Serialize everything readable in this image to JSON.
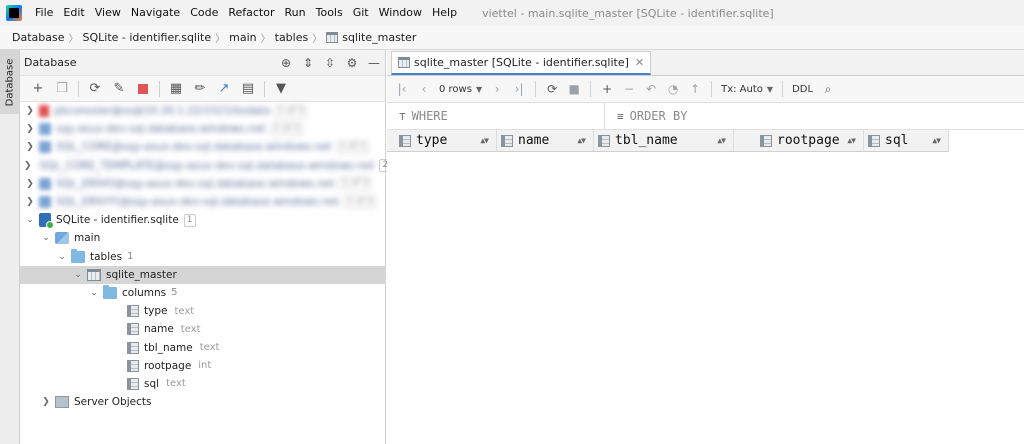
{
  "menu": [
    "File",
    "Edit",
    "View",
    "Navigate",
    "Code",
    "Refactor",
    "Run",
    "Tools",
    "Git",
    "Window",
    "Help"
  ],
  "window_title": "viettel - main.sqlite_master [SQLite - identifier.sqlite]",
  "breadcrumb": [
    "Database",
    "SQLite - identifier.sqlite",
    "main",
    "tables",
    "sqlite_master"
  ],
  "stripe_label": "Database",
  "db_panel": {
    "title": "Database"
  },
  "tree": {
    "blurred": [
      {
        "label": "pbconsoler@ss@10.30.1.22/1521/bsdata",
        "badge": "1 of 2",
        "icon": "red"
      },
      {
        "label": "sqy-asux-dev-sql.database.windows.net",
        "badge": "1 of 2",
        "icon": "blue"
      },
      {
        "label": "SQL_CORE@sqy-asux-dev-sql.database.windows.net",
        "badge": "1 of 2",
        "icon": "blue"
      },
      {
        "label": "SQL_CORE_TEMPLATE@sqy-asux-dev-sql.database.windows.net",
        "badge": "2",
        "icon": "blue"
      },
      {
        "label": "SQL_ERIVO@sqy-asux-dev-sql.database.windows.net",
        "badge": "1 of 2",
        "icon": "blue"
      },
      {
        "label": "SQL_ERIVYY@sqy-asux-dev-sql.database.windows.net",
        "badge": "1 of 2",
        "icon": "blue"
      }
    ],
    "sqlite": {
      "label": "SQLite - identifier.sqlite",
      "badge": "1"
    },
    "main": "main",
    "tables": {
      "label": "tables",
      "count": "1"
    },
    "sqlite_master": "sqlite_master",
    "columns": {
      "label": "columns",
      "count": "5"
    },
    "cols": [
      {
        "name": "type",
        "type": "text"
      },
      {
        "name": "name",
        "type": "text"
      },
      {
        "name": "tbl_name",
        "type": "text"
      },
      {
        "name": "rootpage",
        "type": "int"
      },
      {
        "name": "sql",
        "type": "text"
      }
    ],
    "server_objects": "Server Objects"
  },
  "editor": {
    "tab_label": "sqlite_master [SQLite - identifier.sqlite]",
    "rows_label": "0 rows",
    "tx_label": "Tx: Auto",
    "ddl_label": "DDL",
    "where_label": "WHERE",
    "order_label": "ORDER BY",
    "columns": [
      "type",
      "name",
      "tbl_name",
      "rootpage",
      "sql"
    ]
  }
}
